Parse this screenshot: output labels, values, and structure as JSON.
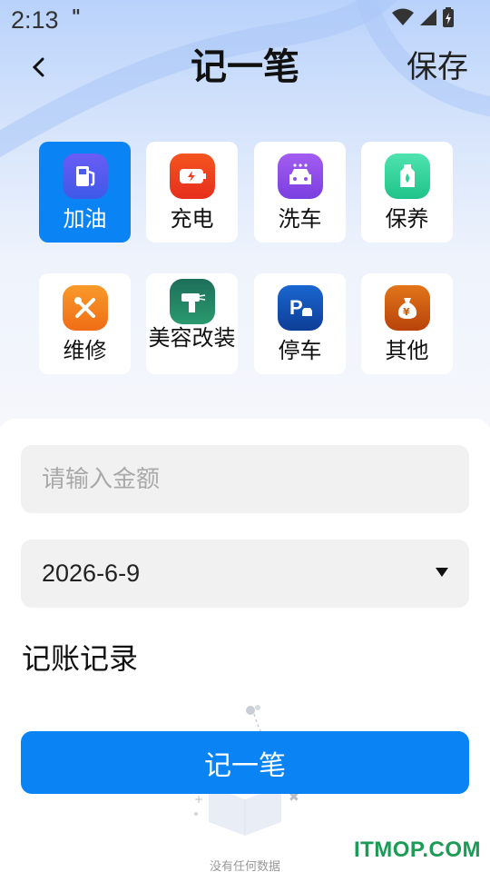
{
  "status_bar": {
    "time": "2:13",
    "notification": "\""
  },
  "nav": {
    "title": "记一笔",
    "save_label": "保存"
  },
  "categories": [
    {
      "label": "加油",
      "icon": "fuel-pump-icon",
      "color": "#4b5bf0",
      "active": true
    },
    {
      "label": "充电",
      "icon": "battery-charge-icon",
      "color": "#ee3b1e"
    },
    {
      "label": "洗车",
      "icon": "car-wash-icon",
      "color": "#8f4fe6"
    },
    {
      "label": "保养",
      "icon": "oil-bottle-icon",
      "color": "#2fd19a"
    },
    {
      "label": "维修",
      "icon": "tools-icon",
      "color": "#f5821f"
    },
    {
      "label": "美容改装",
      "icon": "spray-gun-icon",
      "color": "#1e8a68"
    },
    {
      "label": "停车",
      "icon": "parking-icon",
      "color": "#1453b8"
    },
    {
      "label": "其他",
      "icon": "money-bag-icon",
      "color": "#cf5a0e"
    }
  ],
  "form": {
    "amount_placeholder": "请输入金额",
    "date_value": "2026-6-9"
  },
  "records": {
    "title": "记账记录",
    "empty_text": "没有任何数据"
  },
  "submit_label": "记一笔",
  "watermark": "ITMOP.COM",
  "colors": {
    "accent": "#0a84f5",
    "field_bg": "#f1f1f1"
  }
}
